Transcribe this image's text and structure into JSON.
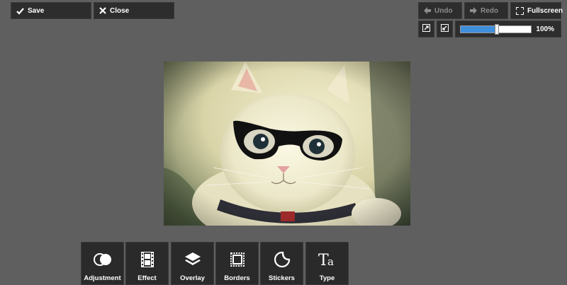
{
  "toolbar": {
    "save_label": "Save",
    "close_label": "Close"
  },
  "history": {
    "undo_label": "Undo",
    "redo_label": "Redo",
    "fullscreen_label": "Fullscreen"
  },
  "zoom": {
    "value_label": "100%",
    "level_fraction": 0.52
  },
  "canvas": {
    "image_description_alt": "Photo"
  },
  "tools": [
    {
      "label": "Adjustment",
      "icon": "adjustment-icon"
    },
    {
      "label": "Effect",
      "icon": "film-icon"
    },
    {
      "label": "Overlay",
      "icon": "layers-icon"
    },
    {
      "label": "Borders",
      "icon": "frame-icon"
    },
    {
      "label": "Stickers",
      "icon": "sticker-icon"
    },
    {
      "label": "Type",
      "icon": "type-icon"
    }
  ],
  "colors": {
    "background": "#5f5f5f",
    "button": "#2d2d2d",
    "accent": "#3f8fdc"
  }
}
